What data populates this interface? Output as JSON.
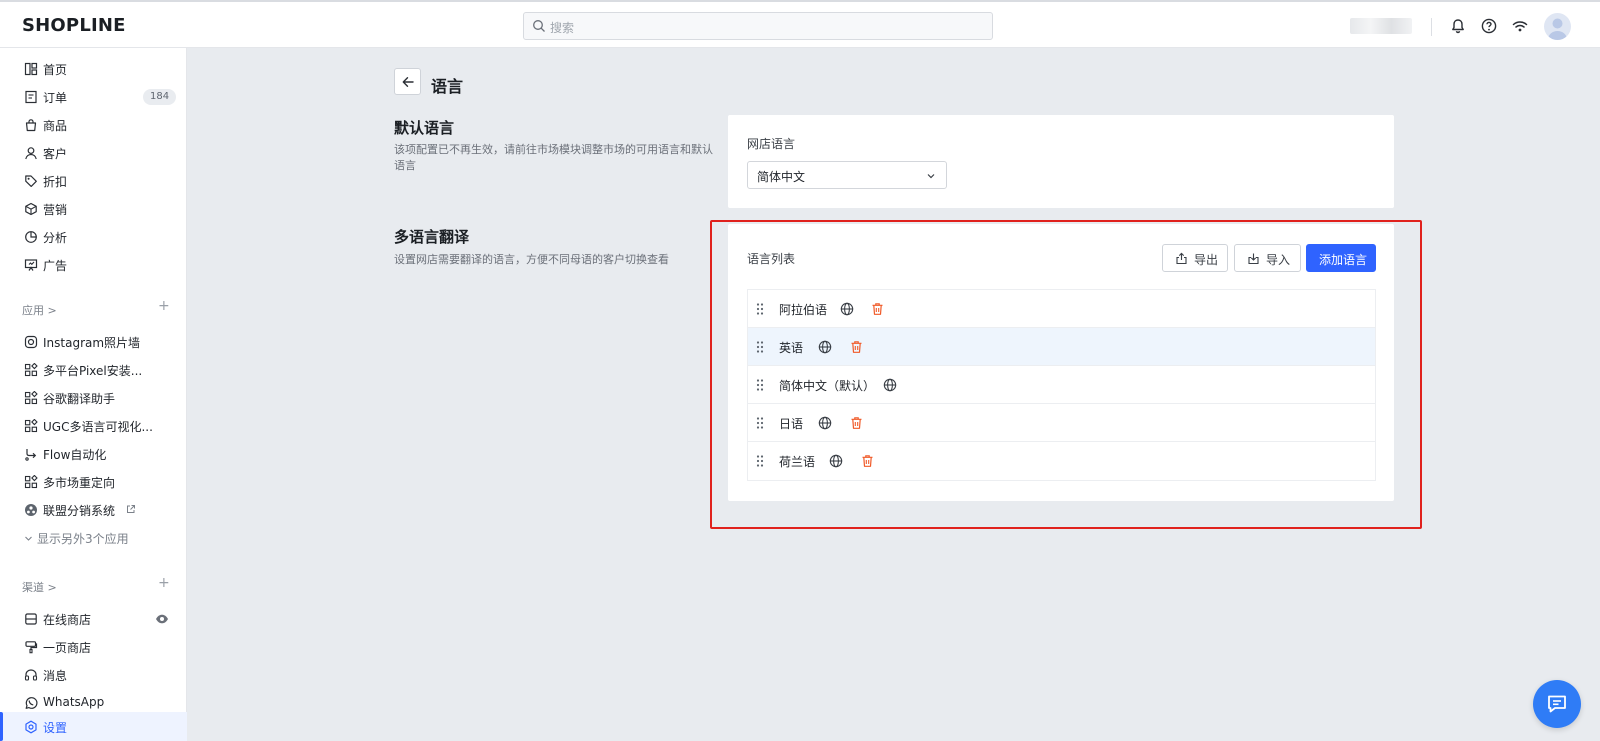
{
  "topbar": {
    "logo": "SHOPLINE",
    "search_placeholder": "搜索"
  },
  "sidebar": {
    "main_items": [
      {
        "label": "首页",
        "icon": "home-icon"
      },
      {
        "label": "订单",
        "icon": "order-icon",
        "badge": "184"
      },
      {
        "label": "商品",
        "icon": "bag-icon"
      },
      {
        "label": "客户",
        "icon": "user-icon"
      },
      {
        "label": "折扣",
        "icon": "tag-icon"
      },
      {
        "label": "营销",
        "icon": "box-icon"
      },
      {
        "label": "分析",
        "icon": "chart-icon"
      },
      {
        "label": "广告",
        "icon": "ad-icon"
      }
    ],
    "apps_title": "应用 >",
    "apps": [
      {
        "label": "Instagram照片墙",
        "icon": "instagram-icon"
      },
      {
        "label": "多平台Pixel安装...",
        "icon": "app-grid-icon"
      },
      {
        "label": "谷歌翻译助手",
        "icon": "app-grid-icon"
      },
      {
        "label": "UGC多语言可视化...",
        "icon": "app-grid-icon"
      },
      {
        "label": "Flow自动化",
        "icon": "flow-icon"
      },
      {
        "label": "多市场重定向",
        "icon": "app-grid-icon"
      },
      {
        "label": "联盟分销系统",
        "icon": "affiliate-icon"
      }
    ],
    "show_more": "显示另外3个应用",
    "channels_title": "渠道 >",
    "channels": [
      {
        "label": "在线商店",
        "icon": "store-icon"
      },
      {
        "label": "一页商店",
        "icon": "brush-icon"
      },
      {
        "label": "消息",
        "icon": "message-icon"
      },
      {
        "label": "WhatsApp",
        "icon": "whatsapp-icon"
      }
    ],
    "settings_label": "设置"
  },
  "page": {
    "title": "语言",
    "default_section": {
      "heading": "默认语言",
      "description": "该项配置已不再生效，请前往市场模块调整市场的可用语言和默认语言",
      "field_label": "网店语言",
      "select_value": "简体中文"
    },
    "translation_section": {
      "heading": "多语言翻译",
      "description": "设置网店需要翻译的语言，方便不同母语的客户切换查看",
      "list_title": "语言列表",
      "export_label": "导出",
      "import_label": "导入",
      "add_label": "添加语言",
      "languages": [
        {
          "name": "阿拉伯语",
          "deletable": true
        },
        {
          "name": "英语",
          "deletable": true,
          "highlighted": true
        },
        {
          "name": "简体中文（默认）",
          "deletable": false
        },
        {
          "name": "日语",
          "deletable": true
        },
        {
          "name": "荷兰语",
          "deletable": true
        }
      ]
    }
  },
  "colors": {
    "accent": "#2f63ff",
    "danger": "#f05a28",
    "annotation_box": "#e0211d"
  }
}
